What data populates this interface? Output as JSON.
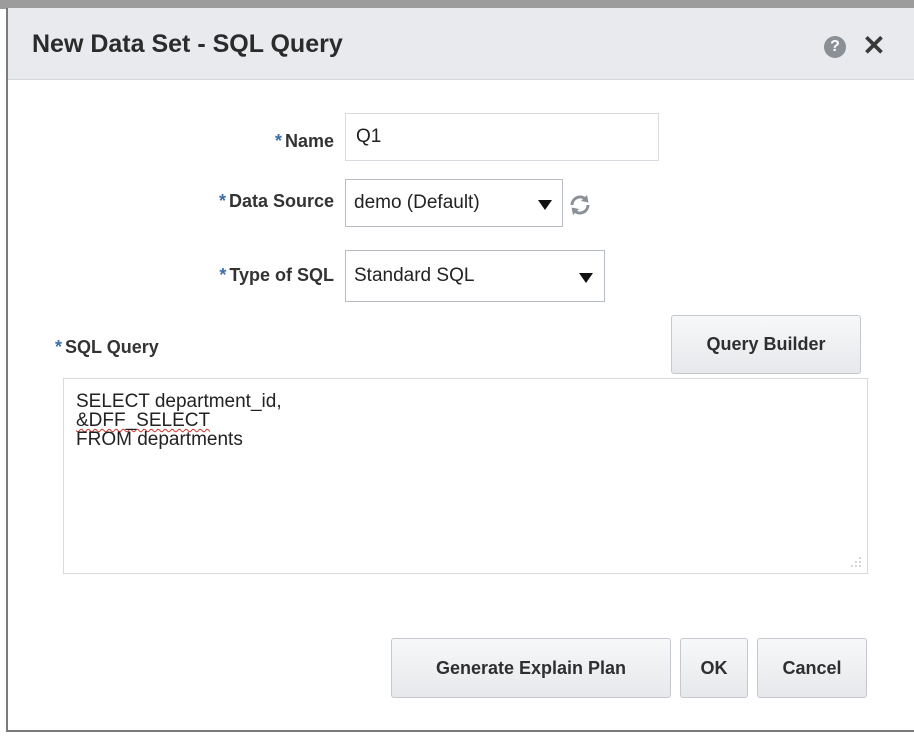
{
  "dialog": {
    "title": "New Data Set - SQL Query",
    "help_icon": "help-icon",
    "close_icon": "close-icon"
  },
  "form": {
    "required_marker": "*",
    "name": {
      "label": "Name",
      "value": "Q1"
    },
    "data_source": {
      "label": "Data Source",
      "value": "demo (Default)",
      "refresh_icon": "refresh-icon"
    },
    "sql_type": {
      "label": "Type of SQL",
      "value": "Standard SQL"
    },
    "sql_query": {
      "label": "SQL Query",
      "lines": [
        "SELECT department_id,",
        "&DFF_SELECT",
        "FROM departments"
      ]
    }
  },
  "buttons": {
    "query_builder": "Query Builder",
    "generate_explain_plan": "Generate Explain Plan",
    "ok": "OK",
    "cancel": "Cancel"
  },
  "colors": {
    "titlebar": "#e8eaee",
    "required_marker": "#3b6da8",
    "spellcheck": "#d0312d"
  }
}
